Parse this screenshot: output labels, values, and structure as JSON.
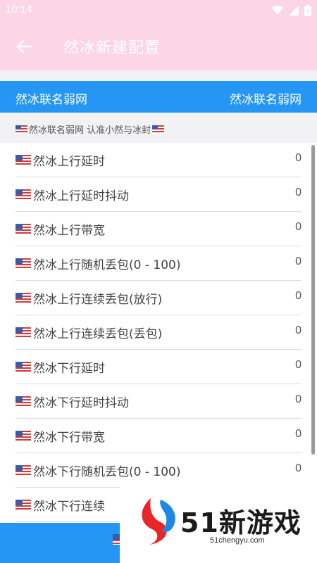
{
  "status_bar": {
    "time": "10:14"
  },
  "app_bar": {
    "title": "然冰新建配置"
  },
  "header": {
    "left_label": "然冰联名弱网",
    "right_label": "然冰联名弱网"
  },
  "subtitle": {
    "text": "然冰联名弱网 认准小然与冰封"
  },
  "rows": [
    {
      "label": "然冰上行延时",
      "value": "0"
    },
    {
      "label": "然冰上行延时抖动",
      "value": "0"
    },
    {
      "label": "然冰上行带宽",
      "value": "0"
    },
    {
      "label": "然冰上行随机丢包(0 - 100)",
      "value": "0"
    },
    {
      "label": "然冰上行连续丢包(放行)",
      "value": "0"
    },
    {
      "label": "然冰上行连续丢包(丢包)",
      "value": "0"
    },
    {
      "label": "然冰下行延时",
      "value": "0"
    },
    {
      "label": "然冰下行延时抖动",
      "value": "0"
    },
    {
      "label": "然冰下行带宽",
      "value": "0"
    },
    {
      "label": "然冰下行随机丢包(0 - 100)",
      "value": "0"
    },
    {
      "label": "然冰下行连续",
      "value": ""
    }
  ],
  "watermark": {
    "brand": "51新游戏",
    "url": "51chengyu.com"
  },
  "colors": {
    "app_bar": "#fcd5e6",
    "accent_blue": "#2596f3"
  },
  "icons": {
    "back": "arrow-left-icon",
    "flag": "us-flag-icon"
  }
}
